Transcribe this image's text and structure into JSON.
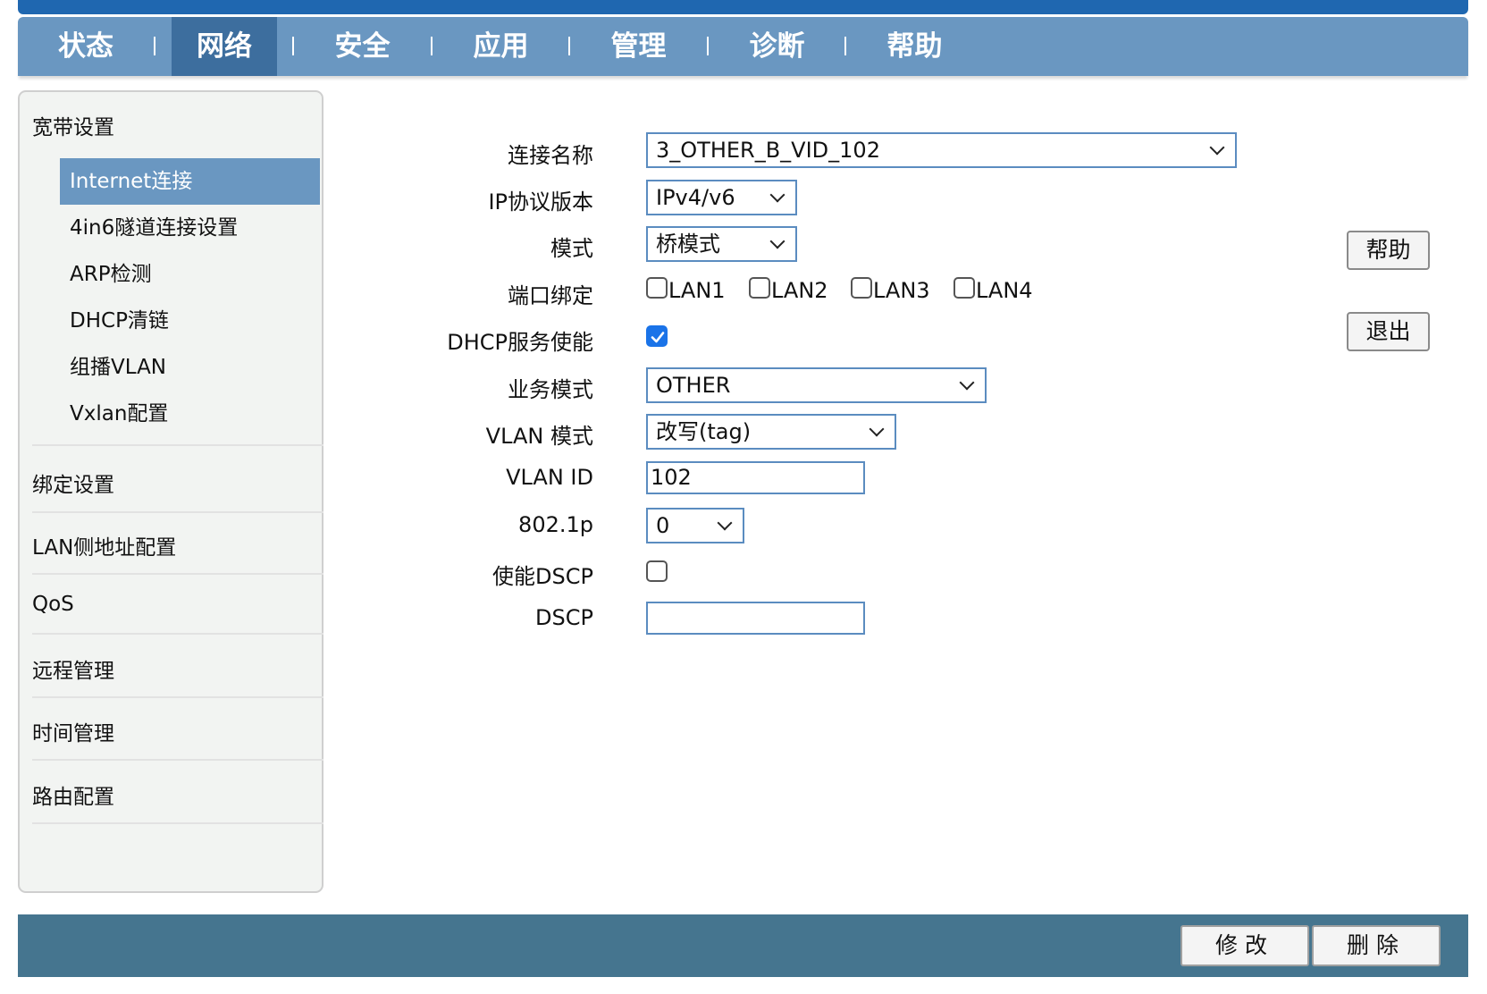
{
  "nav": {
    "items": [
      "状态",
      "网络",
      "安全",
      "应用",
      "管理",
      "诊断",
      "帮助"
    ],
    "active": "网络"
  },
  "sidebar": {
    "group1": "宽带设置",
    "sub_items": [
      "Internet连接",
      "4in6隧道连接设置",
      "ARP检测",
      "DHCP清链",
      "组播VLAN",
      "Vxlan配置"
    ],
    "active_sub": "Internet连接",
    "groups": [
      "绑定设置",
      "LAN侧地址配置",
      "QoS",
      "远程管理",
      "时间管理",
      "路由配置"
    ]
  },
  "form": {
    "conn_name_label": "连接名称",
    "conn_name_value": "3_OTHER_B_VID_102",
    "ip_version_label": "IP协议版本",
    "ip_version_value": "IPv4/v6",
    "mode_label": "模式",
    "mode_value": "桥模式",
    "port_bind_label": "端口绑定",
    "ports": [
      "LAN1",
      "LAN2",
      "LAN3",
      "LAN4"
    ],
    "dhcp_label": "DHCP服务使能",
    "dhcp_checked": true,
    "service_mode_label": "业务模式",
    "service_mode_value": "OTHER",
    "vlan_mode_label": "VLAN 模式",
    "vlan_mode_value": "改写(tag)",
    "vlan_id_label": "VLAN ID",
    "vlan_id_value": "102",
    "p8021_label": "802.1p",
    "p8021_value": "0",
    "dscp_enable_label": "使能DSCP",
    "dscp_enable_checked": false,
    "dscp_label": "DSCP",
    "dscp_value": ""
  },
  "side_buttons": {
    "help": "帮助",
    "logout": "退出"
  },
  "footer": {
    "modify": "修改",
    "delete": "删除"
  }
}
